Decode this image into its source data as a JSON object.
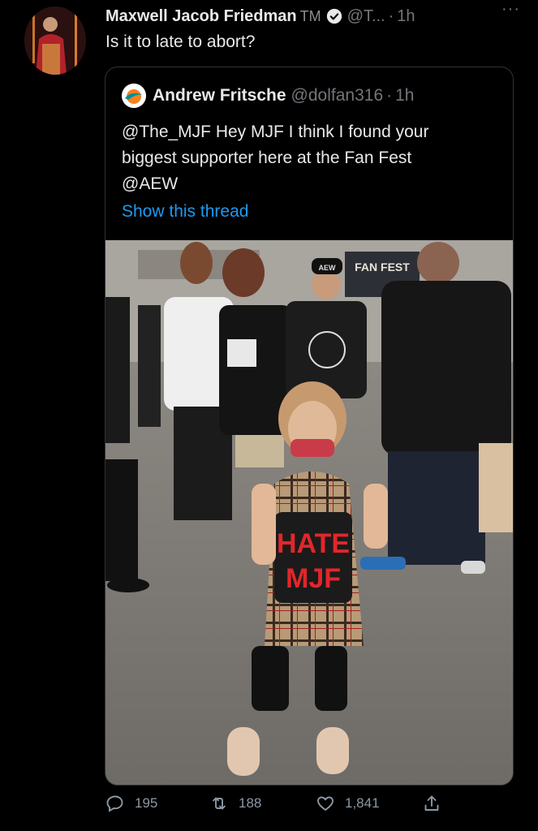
{
  "tweet": {
    "author_name": "Maxwell Jacob Friedman",
    "tm": "TM",
    "handle": "@T...",
    "sep": "·",
    "time": "1h",
    "more": "···",
    "text": "Is it to late to abort?"
  },
  "quote": {
    "author_name": "Andrew Fritsche",
    "handle": "@dolfan316",
    "sep": "·",
    "time": "1h",
    "text": "@The_MJF  Hey MJF I think I found your\nbiggest supporter here at the Fan Fest\n@AEW",
    "show_thread": "Show this thread",
    "photo_sign_text": "FAN FEST",
    "shirt_text_1": "HATE",
    "shirt_text_2": "MJF",
    "cap_text": "AEW"
  },
  "actions": {
    "replies": "195",
    "retweets": "188",
    "likes": "1,841"
  },
  "colors": {
    "background": "#000000",
    "text": "#e7e9ea",
    "muted": "#71767b",
    "link": "#1d9bf0",
    "border": "#2f3336"
  }
}
